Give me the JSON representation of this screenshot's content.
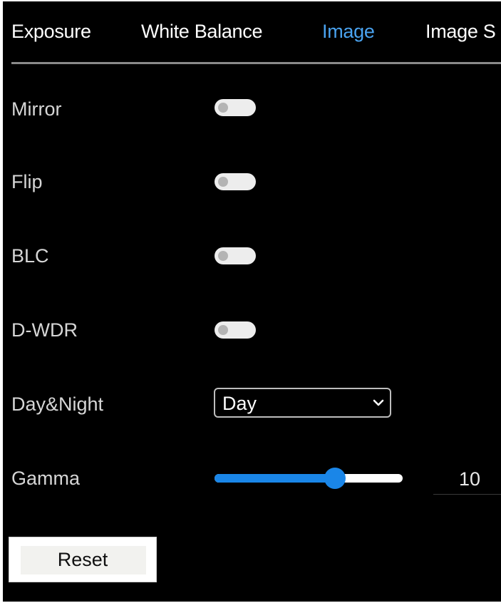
{
  "tabs": [
    {
      "label": "Exposure",
      "active": false
    },
    {
      "label": "White Balance",
      "active": false
    },
    {
      "label": "Image",
      "active": true
    },
    {
      "label": "Image S",
      "active": false
    }
  ],
  "settings": {
    "mirror": {
      "label": "Mirror",
      "enabled": false
    },
    "flip": {
      "label": "Flip",
      "enabled": false
    },
    "blc": {
      "label": "BLC",
      "enabled": false
    },
    "dwdr": {
      "label": "D-WDR",
      "enabled": false
    },
    "day_night": {
      "label": "Day&Night",
      "selected": "Day"
    },
    "gamma": {
      "label": "Gamma",
      "value": "10",
      "slider_fraction": 0.64
    }
  },
  "reset_label": "Reset",
  "colors": {
    "background": "#000000",
    "active_tab": "#4aa3f0",
    "slider_accent": "#1a86e8"
  },
  "icons": {
    "select_arrow": "chevron-down-icon"
  }
}
